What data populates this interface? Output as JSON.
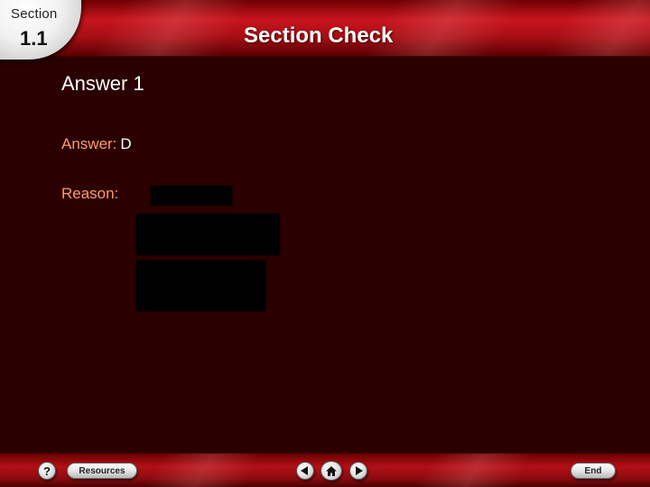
{
  "header": {
    "section_label": "Section",
    "section_number": "1.1",
    "title": "Section Check"
  },
  "content": {
    "answer_heading": "Answer 1",
    "answer_label": "Answer:",
    "answer_value": "D",
    "reason_label": "Reason:"
  },
  "footer": {
    "help_label": "?",
    "resources_label": "Resources",
    "end_label": "End",
    "icons": {
      "help": "question-mark-icon",
      "prev": "triangle-left-icon",
      "home": "house-icon",
      "next": "triangle-right-icon"
    }
  },
  "colors": {
    "background": "#2a0000",
    "header_red": "#c8141e",
    "label_orange": "#ff9a6a",
    "title_white": "#ffffff"
  }
}
